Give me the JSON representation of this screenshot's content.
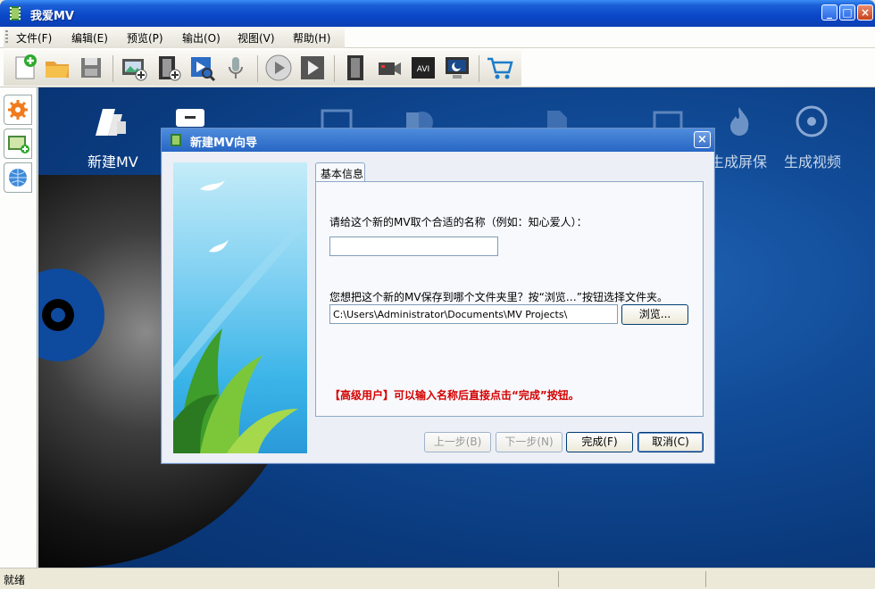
{
  "window": {
    "title": "我爱MV",
    "minimize_label": "_",
    "maximize_label": "□",
    "close_label": "×"
  },
  "menu": {
    "items": [
      {
        "label": "文件(F)"
      },
      {
        "label": "编辑(E)"
      },
      {
        "label": "预览(P)"
      },
      {
        "label": "输出(O)"
      },
      {
        "label": "视图(V)"
      },
      {
        "label": "帮助(H)"
      }
    ]
  },
  "toolbar": {
    "icons": [
      "new-project-icon",
      "open-folder-icon",
      "save-icon",
      "add-image-icon",
      "add-video-icon",
      "find-media-icon",
      "microphone-icon",
      "play-icon",
      "play-next-icon",
      "film-strip-icon",
      "camera-icon",
      "avi-icon",
      "screensaver-icon",
      "cart-icon"
    ],
    "avi_label": "AVI"
  },
  "main": {
    "big_icons": [
      {
        "label": "新建MV"
      },
      {
        "label": "生成屏保"
      },
      {
        "label": "生成视频"
      }
    ]
  },
  "dialog": {
    "title": "新建MV向导",
    "close_label": "×",
    "tab_label": "基本信息",
    "name_prompt": "请给这个新的MV取个合适的名称（例如：知心爱人）：",
    "name_value": "",
    "folder_prompt": "您想把这个新的MV保存到哪个文件夹里？按“浏览…”按钮选择文件夹。",
    "folder_value": "C:\\Users\\Administrator\\Documents\\MV Projects\\",
    "browse_label": "浏览...",
    "hint": "【高级用户】可以输入名称后直接点击“完成”按钮。",
    "buttons": {
      "prev": "上一步(B)",
      "next": "下一步(N)",
      "finish": "完成(F)",
      "cancel": "取消(C)"
    }
  },
  "statusbar": {
    "text": "就绪"
  },
  "colors": {
    "accent": "#0a47c8",
    "hint_red": "#d40000",
    "main_bg": "#114b97"
  }
}
